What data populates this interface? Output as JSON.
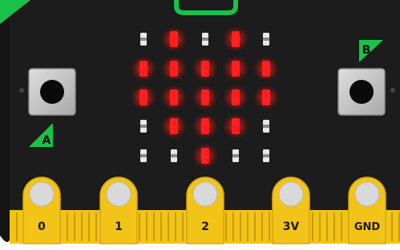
{
  "colors": {
    "board": "#1e1e1e",
    "gold": "#f2c417",
    "gold_dark": "#c99a0a",
    "led_on": "#ff1f1f",
    "led_off": "#e8e8e8",
    "accent_green": "#19c24a",
    "button_body": "#c8c8c8"
  },
  "buttons": {
    "a": {
      "label": "A",
      "icon": "button-a-triangle-icon"
    },
    "b": {
      "label": "B",
      "icon": "button-b-triangle-icon"
    }
  },
  "led_matrix": {
    "rows": [
      [
        0,
        1,
        0,
        1,
        0
      ],
      [
        1,
        1,
        1,
        1,
        1
      ],
      [
        1,
        1,
        1,
        1,
        1
      ],
      [
        0,
        1,
        1,
        1,
        0
      ],
      [
        0,
        0,
        1,
        0,
        0
      ]
    ]
  },
  "pins": [
    {
      "label": "0",
      "size": "large"
    },
    {
      "label": "1",
      "size": "large"
    },
    {
      "label": "2",
      "size": "large"
    },
    {
      "label": "3V",
      "size": "large"
    },
    {
      "label": "GND",
      "size": "large"
    }
  ]
}
